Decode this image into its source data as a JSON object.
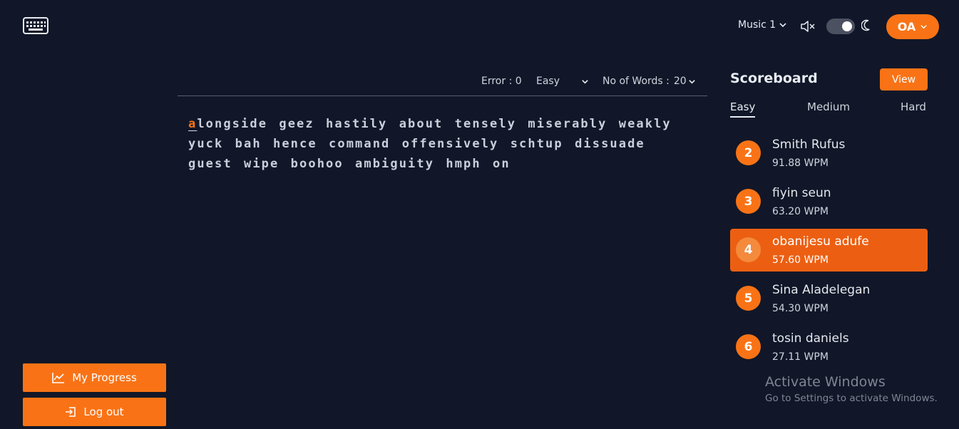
{
  "header": {
    "music_label": "Music 1",
    "avatar_initials": "OA"
  },
  "toolbar": {
    "error_label": "Error : 0",
    "difficulty": "Easy",
    "words_label": "No of Words :",
    "words_value": "20"
  },
  "typing": {
    "current_char": "a",
    "rest_line1": "longside geez hastily about tensely miserably weakly",
    "line2": "yuck bah hence command offensively schtup dissuade",
    "line3": "guest wipe boohoo ambiguity hmph on"
  },
  "buttons": {
    "progress": "My Progress",
    "logout": "Log out"
  },
  "scoreboard": {
    "title": "Scoreboard",
    "view": "View",
    "tabs": [
      "Easy",
      "Medium",
      "Hard"
    ],
    "active_tab": "Easy",
    "entries": [
      {
        "rank": "2",
        "name": "Smith Rufus",
        "wpm": "91.88 WPM"
      },
      {
        "rank": "3",
        "name": "fiyin seun",
        "wpm": "63.20 WPM"
      },
      {
        "rank": "4",
        "name": "obanijesu adufe",
        "wpm": "57.60 WPM"
      },
      {
        "rank": "5",
        "name": "Sina Aladelegan",
        "wpm": "54.30 WPM"
      },
      {
        "rank": "6",
        "name": "tosin daniels",
        "wpm": "27.11 WPM"
      }
    ]
  },
  "watermark": {
    "title": "Activate Windows",
    "subtitle": "Go to Settings to activate Windows."
  },
  "colors": {
    "background": "#111728",
    "accent": "#f97316",
    "highlight_row": "#ec5f12"
  }
}
